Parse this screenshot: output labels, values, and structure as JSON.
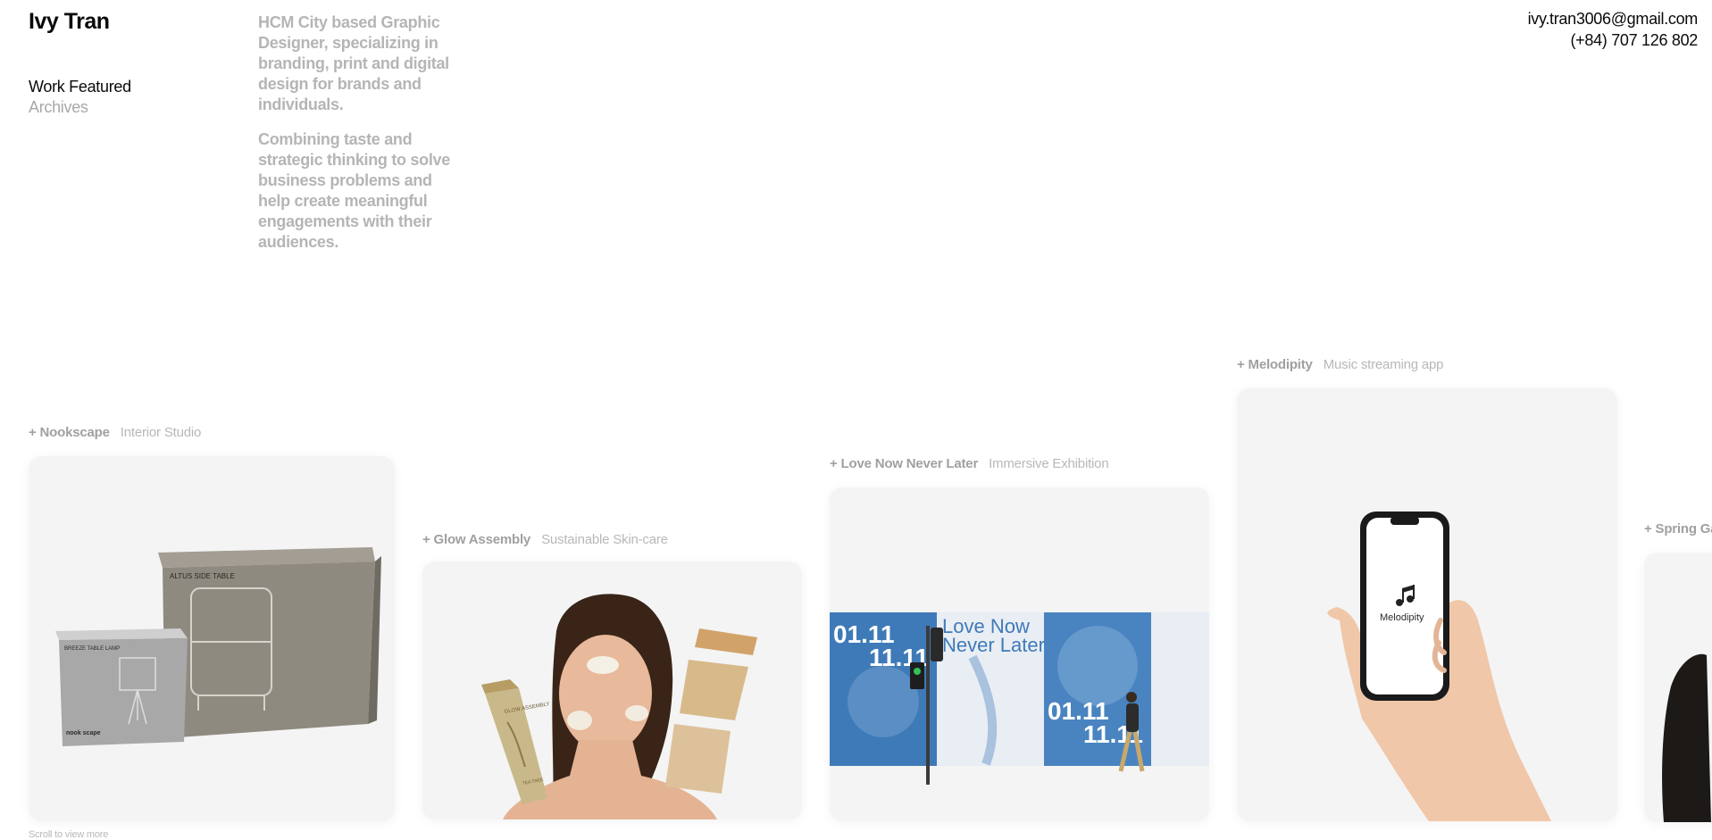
{
  "header": {
    "name": "Ivy Tran",
    "nav": {
      "work_featured": "Work Featured",
      "archives": "Archives"
    },
    "intro": {
      "paragraph_1": "HCM City based Graphic Designer, specializing in branding, print and digital design for brands and individuals.",
      "paragraph_2": "Combining taste and strategic thinking to solve business problems and help create meaningful engagements with their audiences."
    },
    "contact": {
      "email": "ivy.tran3006@gmail.com",
      "phone": "(+84) 707 126 802"
    }
  },
  "projects": [
    {
      "name": "+ Nookscape",
      "description": "Interior Studio",
      "box_label_large": "ALTUS SIDE TABLE",
      "box_label_small": "BREEZE TABLE LAMP",
      "box_brand": "nook scape"
    },
    {
      "name": "+ Glow Assembly",
      "description": "Sustainable Skin-care",
      "tube_label": "GLOW ASSEMBLY",
      "tube_sub": "TEA TREE"
    },
    {
      "name": "+ Love Now Never Later",
      "description": "Immersive Exhibition",
      "poster_date_1": "01.11",
      "poster_date_2": "11.11",
      "poster_title_1": "Love Now",
      "poster_title_2": "Never Later"
    },
    {
      "name": "+ Melodipity",
      "description": "Music streaming app",
      "app_logo_text": "Melodipity"
    },
    {
      "name": "+ Spring Ga",
      "description": ""
    }
  ],
  "footer": {
    "scroll_hint": "Scroll to view more"
  },
  "colors": {
    "card_bg": "#f4f4f4",
    "muted_text": "#a6a6a6",
    "poster_blue": "#3f7ab8"
  }
}
